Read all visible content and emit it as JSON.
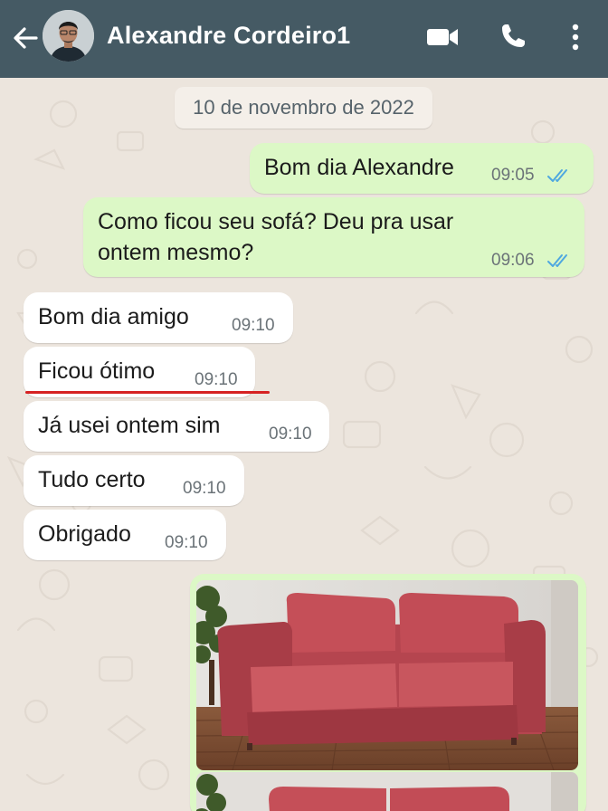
{
  "header": {
    "contact_name": "Alexandre Cordeiro1",
    "back_icon": "arrow-left-icon",
    "video_icon": "video-camera-icon",
    "call_icon": "phone-icon",
    "menu_icon": "more-vertical-icon",
    "background_color": "#455a64"
  },
  "chat": {
    "date_label": "10 de novembro de 2022",
    "outgoing_color": "#dcf8c6",
    "incoming_color": "#ffffff",
    "read_tick_color": "#4fa8e0",
    "messages": [
      {
        "direction": "outgoing",
        "text": "Bom dia Alexandre",
        "time": "09:05",
        "status": "read"
      },
      {
        "direction": "outgoing",
        "text": "Como ficou seu sofá? Deu pra usar\nontem mesmo?",
        "time": "09:06",
        "status": "read"
      },
      {
        "direction": "incoming",
        "text": "Bom dia amigo",
        "time": "09:10"
      },
      {
        "direction": "incoming",
        "text": "Ficou ótimo",
        "time": "09:10",
        "highlighted": true
      },
      {
        "direction": "incoming",
        "text": "Já usei ontem sim",
        "time": "09:10"
      },
      {
        "direction": "incoming",
        "text": "Tudo certo",
        "time": "09:10"
      },
      {
        "direction": "incoming",
        "text": "Obrigado",
        "time": "09:10"
      }
    ],
    "photo_message": {
      "direction": "outgoing",
      "content": "photos of red sofa"
    }
  }
}
